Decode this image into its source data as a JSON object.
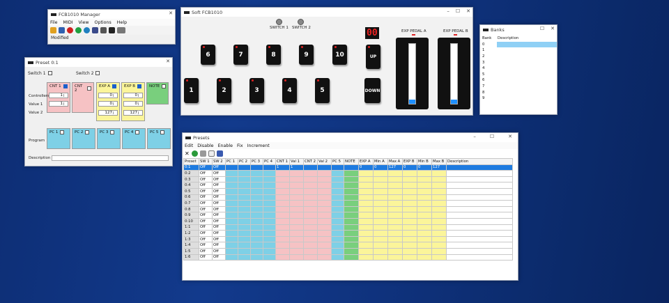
{
  "manager": {
    "title": "FCB1010 Manager",
    "menu": [
      "File",
      "MIDI",
      "View",
      "Options",
      "Help"
    ],
    "status": "Modified"
  },
  "soft": {
    "title": "Soft FCB1010",
    "switch1": "SWITCH 1",
    "switch2": "SWITCH 2",
    "display": "00",
    "exp_a": "EXP PEDAL A",
    "exp_b": "EXP PEDAL B",
    "top_pedals": [
      "6",
      "7",
      "8",
      "9",
      "10",
      "UP"
    ],
    "bottom_pedals": [
      "1",
      "2",
      "3",
      "4",
      "5",
      "DOWN"
    ],
    "exp_a_level": 0.07,
    "exp_b_level": 0.07
  },
  "banks": {
    "title": "Banks",
    "col_bank": "Bank",
    "col_desc": "Description",
    "rows": [
      "0",
      "1",
      "2",
      "3",
      "4",
      "5",
      "6",
      "7",
      "8",
      "9"
    ]
  },
  "preset_ed": {
    "title": "Preset 0:1",
    "switch1": "Switch 1",
    "switch2": "Switch 2",
    "cnt1": "CNT 1",
    "cnt2": "CNT 2",
    "expa": "EXP A",
    "expb": "EXP B",
    "note": "NOTE",
    "controllers": "Controllers",
    "value1": "Value 1",
    "value2": "Value 2",
    "program": "Program",
    "description": "Description",
    "pc": [
      "PC 1",
      "PC 2",
      "PC 3",
      "PC 4",
      "PC 5"
    ],
    "cnt1_vals": [
      "1",
      "1"
    ],
    "expa_vals": [
      "0",
      "0",
      "127"
    ],
    "expb_vals": [
      "0",
      "0",
      "127"
    ]
  },
  "presets": {
    "title": "Presets",
    "menu": [
      "Edit",
      "Disable",
      "Enable",
      "Fix",
      "Increment"
    ],
    "columns": [
      "Preset",
      "SW 1",
      "SW 2",
      "PC 1",
      "PC 2",
      "PC 3",
      "PC 4",
      "CNT 1",
      "Val 1",
      "CNT 2",
      "Val 2",
      "PC 5",
      "NOTE",
      "EXP A",
      "Min A",
      "Max A",
      "EXP B",
      "Min B",
      "Max B",
      "Description"
    ],
    "rows": [
      [
        "0:1",
        "Off",
        "Off",
        "",
        "",
        "",
        "",
        "1",
        "1",
        "",
        "",
        "",
        "",
        "0",
        "0",
        "127",
        "0",
        "0",
        "127",
        ""
      ],
      [
        "0:2",
        "Off",
        "Off"
      ],
      [
        "0:3",
        "Off",
        "Off"
      ],
      [
        "0:4",
        "Off",
        "Off"
      ],
      [
        "0:5",
        "Off",
        "Off"
      ],
      [
        "0:6",
        "Off",
        "Off"
      ],
      [
        "0:7",
        "Off",
        "Off"
      ],
      [
        "0:8",
        "Off",
        "Off"
      ],
      [
        "0:9",
        "Off",
        "Off"
      ],
      [
        "0:10",
        "Off",
        "Off"
      ],
      [
        "1:1",
        "Off",
        "Off"
      ],
      [
        "1:2",
        "Off",
        "Off"
      ],
      [
        "1:3",
        "Off",
        "Off"
      ],
      [
        "1:4",
        "Off",
        "Off"
      ],
      [
        "1:5",
        "Off",
        "Off"
      ],
      [
        "1:6",
        "Off",
        "Off"
      ]
    ]
  },
  "colors": {
    "pink": "#f6c2c4",
    "yellow": "#fbf59a",
    "blue": "#7ed0e6",
    "green": "#79cf7d",
    "select": "#1e7be0"
  }
}
